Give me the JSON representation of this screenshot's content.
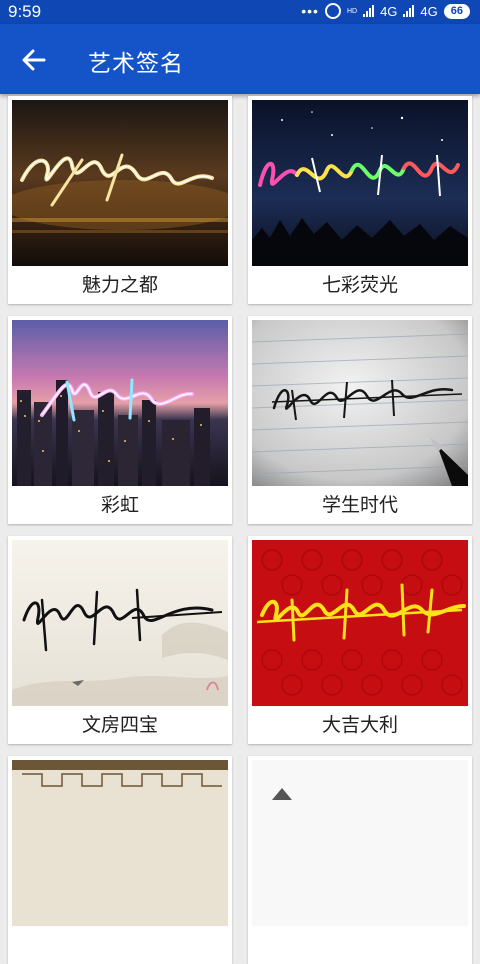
{
  "status_bar": {
    "time": "9:59",
    "network_1": "4G",
    "network_2": "4G",
    "hd_label": "HD",
    "battery": "66"
  },
  "app_bar": {
    "title": "艺术签名"
  },
  "styles": [
    {
      "label": "魅力之都"
    },
    {
      "label": "七彩荧光"
    },
    {
      "label": "彩虹"
    },
    {
      "label": "学生时代"
    },
    {
      "label": "文房四宝"
    },
    {
      "label": "大吉大利"
    }
  ],
  "colors": {
    "status_bar": "#0f47b5",
    "app_bar": "#1553c8",
    "background": "#ececec"
  }
}
